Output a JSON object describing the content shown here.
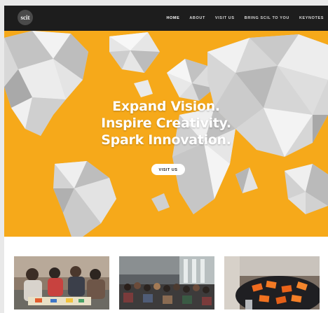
{
  "nav": {
    "logo": "scit",
    "links": [
      {
        "label": "HOME",
        "active": true
      },
      {
        "label": "ABOUT"
      },
      {
        "label": "VISIT US"
      },
      {
        "label": "BRING SCIL TO YOU"
      },
      {
        "label": "KEYNOTES"
      }
    ]
  },
  "hero": {
    "lines": [
      "Expand Vision.",
      "Inspire Creativity.",
      "Spark Innovation."
    ],
    "button": "VISIT US",
    "background_color": "#f6a91a"
  },
  "cards": [
    {
      "image": "classroom-activity-photo"
    },
    {
      "image": "auditorium-audience-photo"
    },
    {
      "image": "orange-tiles-table-photo"
    }
  ]
}
